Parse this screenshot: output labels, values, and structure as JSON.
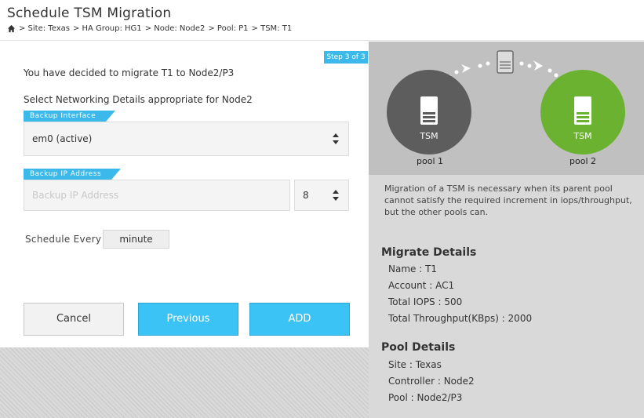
{
  "header": {
    "title": "Schedule TSM Migration",
    "breadcrumb": [
      {
        "label": "> Site: Texas"
      },
      {
        "label": "> HA Group: HG1"
      },
      {
        "label": "> Node: Node2"
      },
      {
        "label": "> Pool: P1"
      },
      {
        "label": "> TSM: T1"
      }
    ]
  },
  "form": {
    "step": "Step 3 of 3",
    "intro": "You have decided to migrate T1 to Node2/P3",
    "select_title": "Select Networking Details appropriate for Node2",
    "backup_interface": {
      "label": "Backup Interface",
      "value": "em0 (active)"
    },
    "backup_ip": {
      "label": "Backup IP Address",
      "placeholder": "Backup IP Address",
      "netmask": "8"
    },
    "schedule": {
      "label": "Schedule Every",
      "value": "minute"
    },
    "buttons": {
      "cancel": "Cancel",
      "previous": "Previous",
      "add": "ADD"
    }
  },
  "diagram": {
    "source": {
      "tsm_label": "TSM",
      "pool_label": "pool 1",
      "color": "#5d5d5d"
    },
    "target": {
      "tsm_label": "TSM",
      "pool_label": "pool 2",
      "color": "#6ab22f"
    }
  },
  "info": {
    "description": "Migration of a TSM is necessary when its parent pool cannot satisfy the required increment in iops/throughput, but the other pools can.",
    "migrate_details": {
      "title": "Migrate Details",
      "items": [
        "Name : T1",
        "Account : AC1",
        "Total IOPS : 500",
        "Total Throughput(KBps) : 2000"
      ]
    },
    "pool_details": {
      "title": "Pool Details",
      "items": [
        "Site : Texas",
        "Controller : Node2",
        "Pool : Node2/P3"
      ]
    }
  },
  "colors": {
    "accent": "#3bc3f5",
    "tag": "#3bb9ea"
  }
}
